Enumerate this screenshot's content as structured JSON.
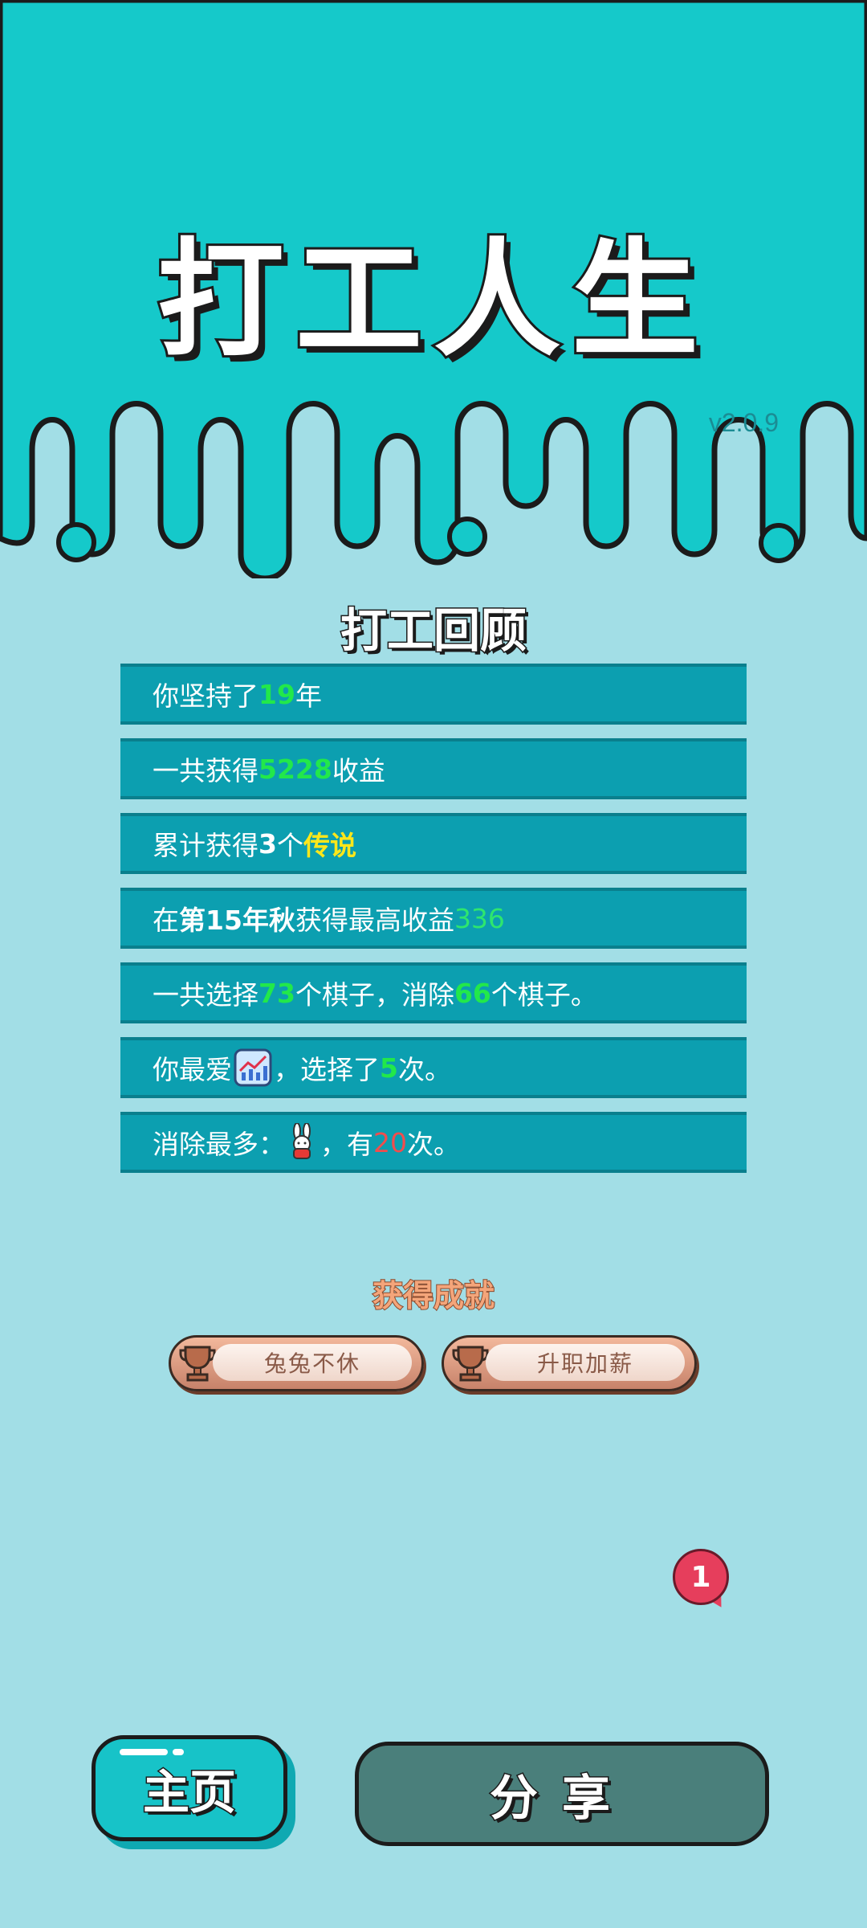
{
  "header": {
    "title": "打工人生",
    "version": "v2.0.9"
  },
  "review": {
    "title": "打工回顾",
    "rows": [
      {
        "pre": "你坚持了",
        "v1": "19",
        "post": "年"
      },
      {
        "pre": "一共获得",
        "v1": "5228",
        "post": "收益"
      },
      {
        "pre": "累计获得",
        "v1": "3",
        "mid": "个",
        "v2": "传说"
      },
      {
        "pre": "在 ",
        "v1": "第15年秋",
        "mid": " 获得最高收益",
        "v2": "336"
      },
      {
        "pre": "一共选择",
        "v1": "73",
        "mid": "个棋子，消除",
        "v2": "66",
        "post": "个棋子。"
      },
      {
        "pre": "你最爱",
        "icon": "chart-up-icon",
        "mid": "，选择了",
        "v1": "5",
        "post": "次。"
      },
      {
        "pre": "消除最多：",
        "icon": "rabbit-icon",
        "mid": "，有",
        "v1": "20",
        "post": "次。"
      }
    ]
  },
  "achievements": {
    "title": "获得成就",
    "items": [
      {
        "label": "兔兔不休",
        "icon": "trophy-icon"
      },
      {
        "label": "升职加薪",
        "icon": "trophy-icon"
      }
    ]
  },
  "notification": {
    "count": "1"
  },
  "buttons": {
    "home": "主页",
    "share": "分享"
  },
  "colors": {
    "top_bg": "#15c9ca",
    "bottom_bg": "#a2dee6",
    "row_bg": "#0c9fb0",
    "highlight_green": "#22e84a",
    "highlight_yellow": "#ffe71a",
    "highlight_red": "#f24d4d"
  }
}
